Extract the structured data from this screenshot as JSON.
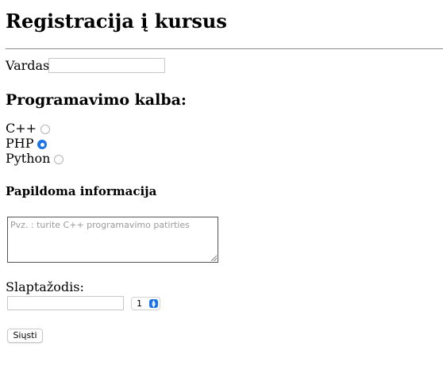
{
  "page": {
    "title": "Registracija į kursus"
  },
  "form": {
    "name_label": "Vardas:",
    "name_value": "",
    "language_heading": "Programavimo kalba:",
    "languages": [
      {
        "label": "C++",
        "checked": false
      },
      {
        "label": "PHP",
        "checked": true
      },
      {
        "label": "Python",
        "checked": false
      }
    ],
    "extra_heading": "Papildoma informacija",
    "extra_placeholder": "Pvz. : turite C++ programavimo patirties",
    "password_label": "Slaptažodis:",
    "password_value": "",
    "select_value": "1",
    "submit_label": "Siųsti"
  },
  "colors": {
    "accent": "#1a73e8"
  }
}
